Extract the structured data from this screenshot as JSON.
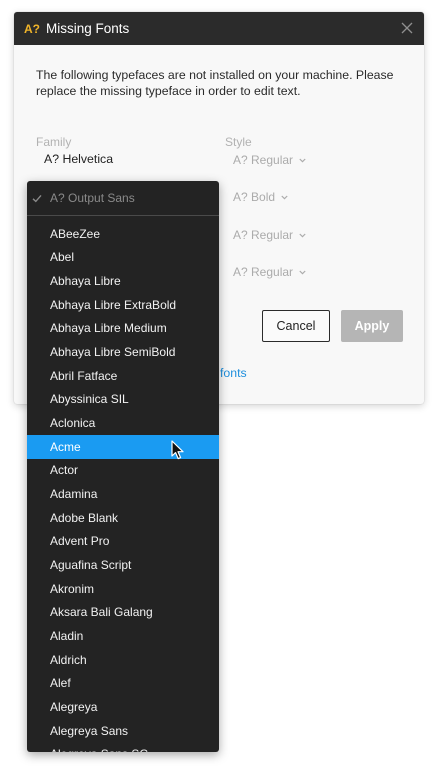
{
  "dialog": {
    "title_glyph": "A?",
    "title": "Missing Fonts",
    "description": "The following typefaces are not installed on your machine. Please replace the missing typeface in order to edit text.",
    "family_header": "Family",
    "style_header": "Style",
    "rows": [
      {
        "family": "A? Helvetica",
        "style": "A? Regular"
      },
      {
        "family": "",
        "style": "A? Bold"
      },
      {
        "family": "",
        "style": "A? Regular"
      },
      {
        "family": "",
        "style": "A? Regular"
      }
    ],
    "cancel_label": "Cancel",
    "apply_label": "Apply",
    "local_fonts_link": "ocal fonts"
  },
  "dropdown": {
    "selected": "A? Output Sans",
    "items": [
      "ABeeZee",
      "Abel",
      "Abhaya Libre",
      "Abhaya Libre ExtraBold",
      "Abhaya Libre Medium",
      "Abhaya Libre SemiBold",
      "Abril Fatface",
      "Abyssinica SIL",
      "Aclonica",
      "Acme",
      "Actor",
      "Adamina",
      "Adobe Blank",
      "Advent Pro",
      "Aguafina Script",
      "Akronim",
      "Aksara Bali Galang",
      "Aladin",
      "Aldrich",
      "Alef",
      "Alegreya",
      "Alegreya Sans",
      "Alegreya Sans SC"
    ],
    "highlighted": "Acme"
  },
  "colors": {
    "titlebar": "#2b2b2b",
    "title_glyph": "#f0b429",
    "accent": "#1a9bf2",
    "link": "#1f8fdd",
    "dropdown_bg": "#232323",
    "apply_disabled": "#b5b5b5"
  }
}
